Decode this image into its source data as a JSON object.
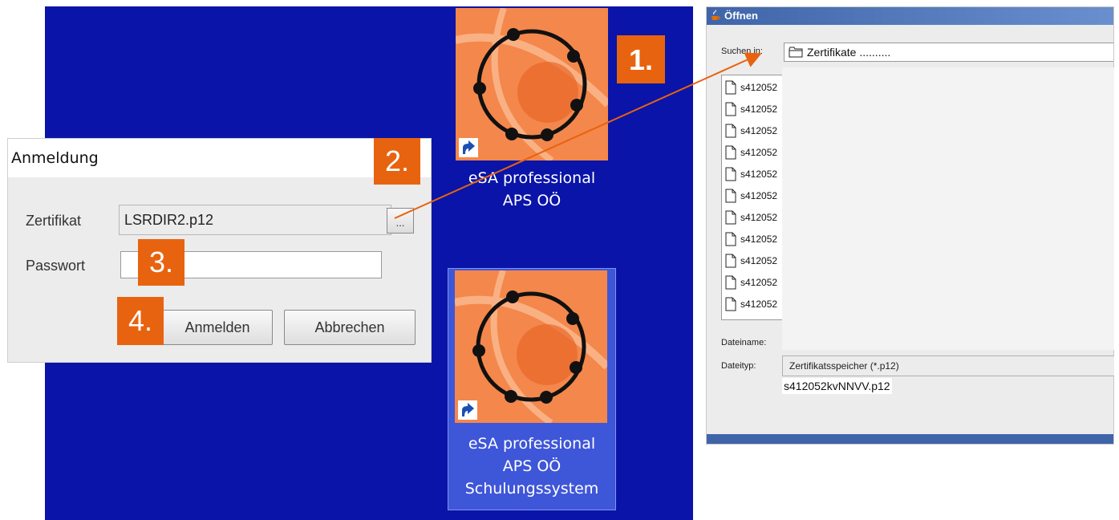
{
  "desktop": {
    "icons": [
      {
        "caption_lines": [
          "eSA professional",
          "APS OÖ"
        ]
      },
      {
        "caption_lines": [
          "eSA professional",
          "APS OÖ",
          "Schulungssystem"
        ]
      }
    ],
    "background_color": "#0a14a8",
    "icon_color": "#f47c3c"
  },
  "login_dialog": {
    "title": "Anmeldung",
    "certificate_label": "Zertifikat",
    "certificate_value": "LSRDIR2.p12",
    "browse_label": "...",
    "password_label": "Passwort",
    "password_value": "",
    "login_button": "Anmelden",
    "cancel_button": "Abbrechen"
  },
  "steps": [
    "1.",
    "2.",
    "3.",
    "4."
  ],
  "step_color": "#e8630f",
  "open_dialog": {
    "title": "Öffnen",
    "look_in_label": "Suchen in:",
    "look_in_value": "Zertifikate ..........",
    "files": [
      "s412052",
      "s412052",
      "s412052",
      "s412052",
      "s412052",
      "s412052",
      "s412052",
      "s412052",
      "s412052",
      "s412052",
      "s412052"
    ],
    "file_name_label": "Dateiname:",
    "file_type_label": "Dateityp:",
    "file_type_value": "Zertifikatsspeicher (*.p12)",
    "file_name_value": "s412052kvNNVV.p12"
  }
}
